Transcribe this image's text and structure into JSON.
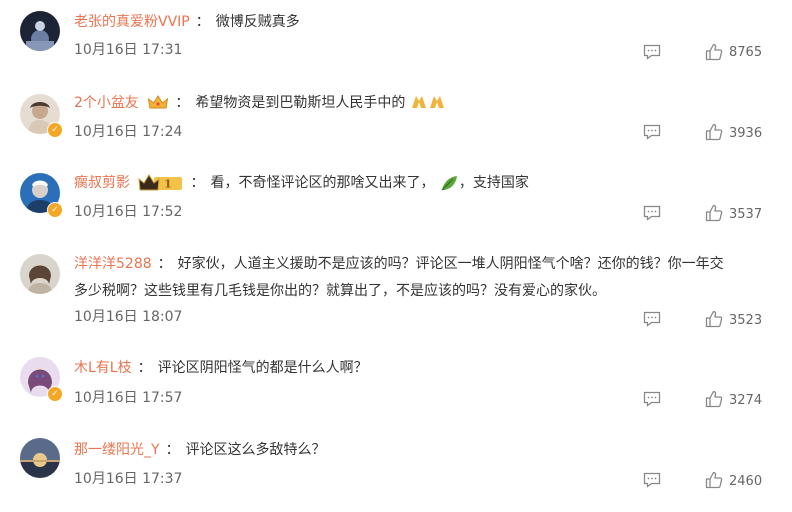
{
  "comments": [
    {
      "user": "老张的真爱粉VVIP",
      "sep": "：",
      "text": "微博反贼真多",
      "time": "10月16日 17:31",
      "likes": "8765"
    },
    {
      "user": "2个小盆友",
      "sep": "：",
      "text": "希望物资是到巴勒斯坦人民手中的",
      "time": "10月16日 17:24",
      "likes": "3936"
    },
    {
      "user": "瘸叔剪影",
      "sep": "：",
      "text": "看，不奇怪评论区的那啥又出来了，",
      "text_b": "，支持国家",
      "time": "10月16日 17:52",
      "likes": "3537"
    },
    {
      "user": "洋洋洋5288",
      "sep": "：",
      "text": "好家伙，人道主义援助不是应该的吗？评论区一堆人阴阳怪气个啥？还你的钱？你一年交",
      "text2": "多少税啊？这些钱里有几毛钱是你出的？就算出了，不是应该的吗？没有爱心的家伙。",
      "time": "10月16日 18:07",
      "likes": "3523"
    },
    {
      "user": "木L有L枝",
      "sep": "：",
      "text": "评论区阴阳怪气的都是什么人啊？",
      "time": "10月16日 17:57",
      "likes": "3274"
    },
    {
      "user": "那一缕阳光_Y",
      "sep": "：",
      "text": "评论区这么多敌特么？",
      "time": "10月16日 17:37",
      "likes": "2460"
    }
  ],
  "icons": {
    "reply": "comment-icon",
    "like": "thumbs-up-icon",
    "verified": "verified-badge-icon",
    "crown": "crown-badge-icon",
    "pray": "folded-hands-emoji",
    "leaf": "leaf-emoji"
  },
  "badges": {
    "level": "1"
  },
  "colors": {
    "username": "#eb7350",
    "text": "#333333",
    "meta": "#666666",
    "verified": "#f5a623"
  }
}
